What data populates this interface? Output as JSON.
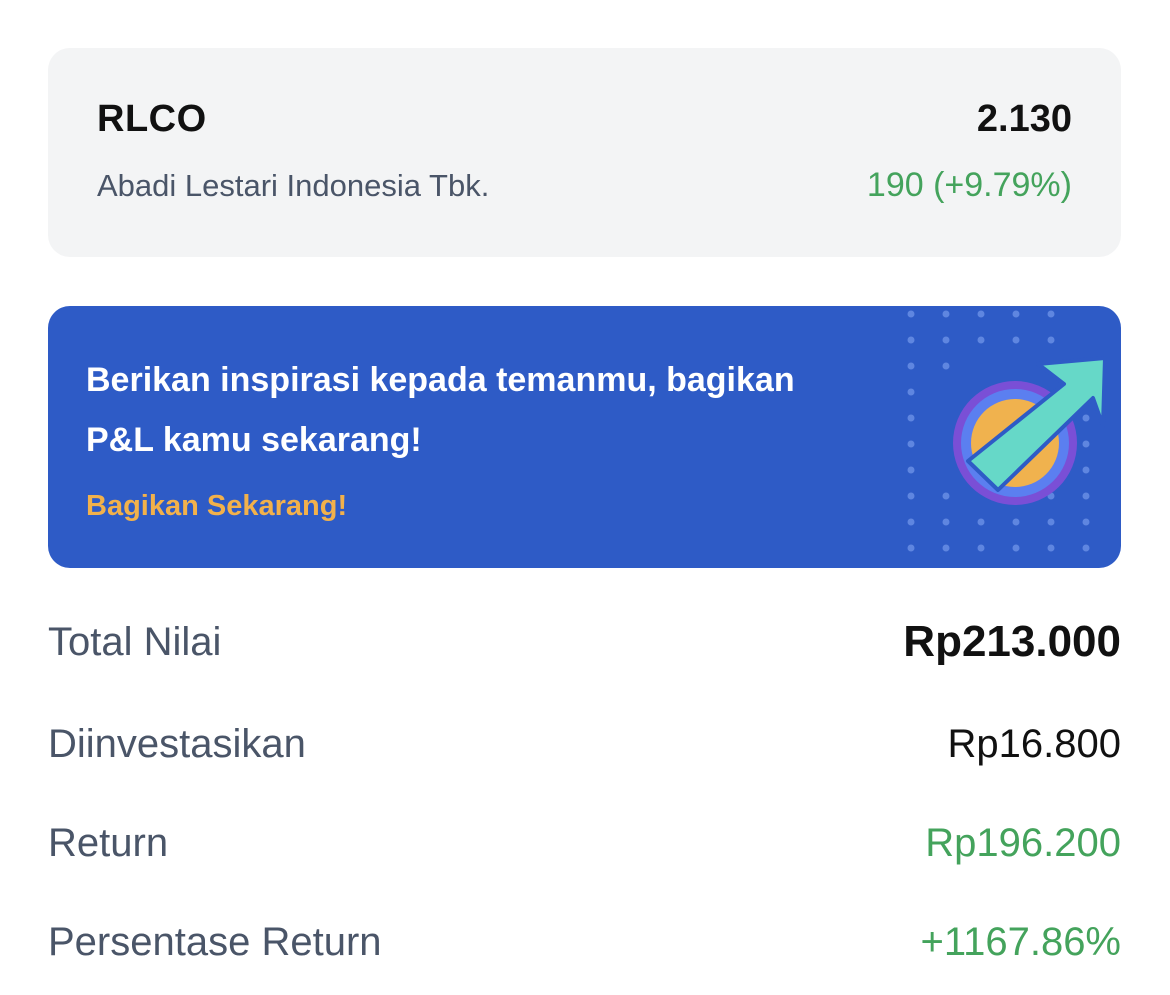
{
  "stock": {
    "ticker": "RLCO",
    "company_name": "Abadi Lestari Indonesia Tbk.",
    "price": "2.130",
    "change": "190 (+9.79%)"
  },
  "banner": {
    "message": "Berikan inspirasi kepada temanmu, bagikan P&L kamu sekarang!",
    "cta_label": "Bagikan Sekarang!",
    "icon": "growth-arrow-icon"
  },
  "summary": {
    "total_value": {
      "label": "Total Nilai",
      "value": "Rp213.000"
    },
    "invested": {
      "label": "Diinvestasikan",
      "value": "Rp16.800"
    },
    "return": {
      "label": "Return",
      "value": "Rp196.200"
    },
    "return_pct": {
      "label": "Persentase Return",
      "value": "+1167.86%"
    }
  },
  "colors": {
    "positive": "#44a35c",
    "banner_bg": "#2e5bc6",
    "cta": "#f2b14b",
    "card_bg": "#f3f4f5"
  }
}
